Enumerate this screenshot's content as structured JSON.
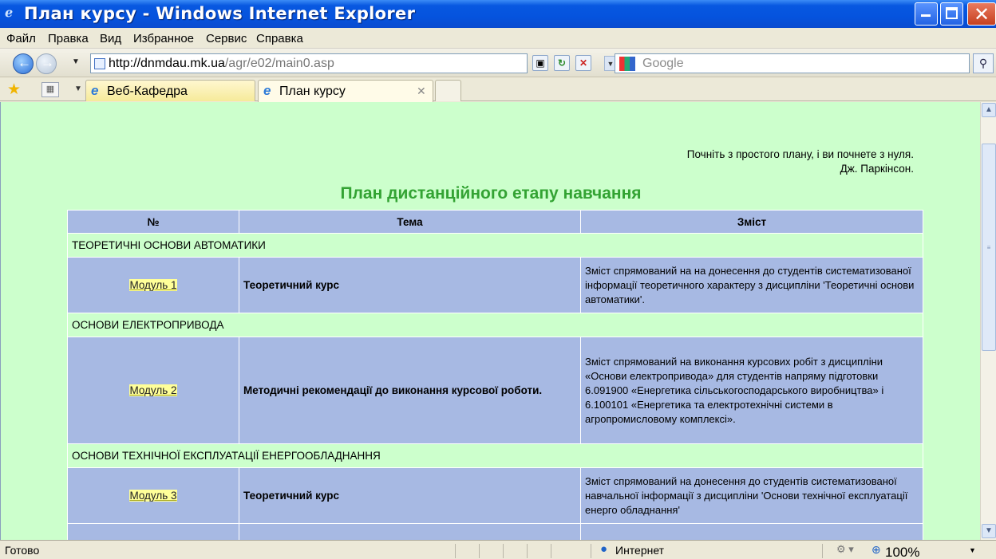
{
  "window": {
    "title": "План курсу - Windows Internet Explorer"
  },
  "menu": [
    "Файл",
    "Правка",
    "Вид",
    "Избранное",
    "Сервис",
    "Справка"
  ],
  "address": {
    "host": "http://dnmdau.mk.ua",
    "path": "/agr/e02/main0.asp"
  },
  "search": {
    "placeholder": "Google"
  },
  "tabs": [
    {
      "label": "Веб-Кафедра"
    },
    {
      "label": "План курсу"
    }
  ],
  "page": {
    "quote_line1": "Почніть з простого плану, і ви почнете з нуля.",
    "quote_line2": "Дж. Паркінсон.",
    "title": "План дистанційного етапу навчання",
    "columns": [
      "№",
      "Тема",
      "Зміст"
    ],
    "rows": [
      {
        "section": "ТЕОРЕТИЧНІ ОСНОВИ АВТОМАТИКИ",
        "module": "Модуль 1",
        "topic": "Теоретичний курс",
        "desc": "Зміст спрямований на на донесення до студентів систематизованої інформації теоретичного характеру з дисципліни 'Теоретичні основи автоматики'."
      },
      {
        "section": "ОСНОВИ ЕЛЕКТРОПРИВОДА",
        "module": "Модуль 2",
        "topic": "Методичні рекомендації до виконання курсової роботи.",
        "desc": "Зміст спрямований на виконання курсових робіт з дисципліни «Основи електропривода» для студентів напряму підготовки 6.091900 «Енергетика сільськогосподарського виробництва» і 6.100101 «Енергетика та електротехнічні системи в агропромисловому комплексі»."
      },
      {
        "section": "ОСНОВИ ТЕХНІЧНОЇ ЕКСПЛУАТАЦІЇ ЕНЕРГООБЛАДНАННЯ",
        "module": "Модуль 3",
        "topic": "Теоретичний курс",
        "desc": "Зміст спрямований на донесення до студентів систематизованої навчальної інформації з дисципліни 'Основи технічної експлуатації енерго обладнання'"
      }
    ]
  },
  "status": {
    "text": "Готово",
    "zone": "Интернет",
    "zoom": "100%"
  }
}
